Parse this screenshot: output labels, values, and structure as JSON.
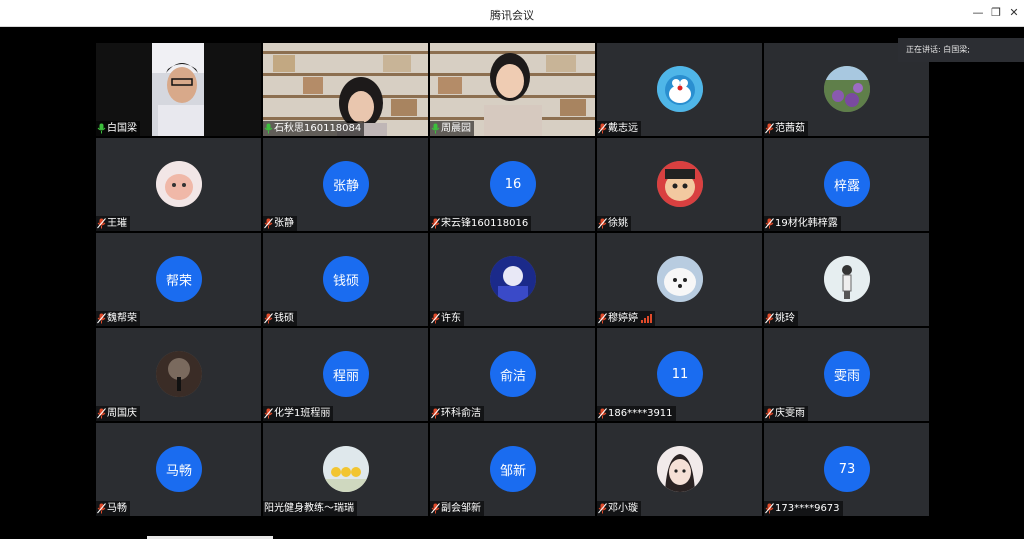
{
  "window": {
    "title": "腾讯会议",
    "speaking_label": "正在讲话: 白国梁;"
  },
  "colors": {
    "avatar_blue": "#1a6cf0",
    "tile_bg": "#2b2d31",
    "active_border": "#3c9b3c",
    "mic_on": "#3cbf3c",
    "mic_muted": "#e04a2a"
  },
  "participants": [
    {
      "name": "白国梁",
      "type": "video",
      "mic": "on",
      "active": true
    },
    {
      "name": "石秋思160118084",
      "type": "video",
      "mic": "on"
    },
    {
      "name": "周晨园",
      "type": "video",
      "mic": "on"
    },
    {
      "name": "戴志远",
      "type": "image",
      "mic": "muted",
      "icon": "doraemon-avatar"
    },
    {
      "name": "范茜茹",
      "type": "image",
      "mic": "muted",
      "icon": "flowers-avatar"
    },
    {
      "name": "王璀",
      "type": "image",
      "mic": "muted",
      "icon": "pink-face-avatar"
    },
    {
      "name": "张静",
      "type": "initials",
      "initials": "张静",
      "mic": "muted"
    },
    {
      "name": "宋云锋160118016",
      "type": "initials",
      "initials": "16",
      "mic": "muted"
    },
    {
      "name": "徐姚",
      "type": "image",
      "mic": "muted",
      "icon": "cartoon-boy-avatar"
    },
    {
      "name": "19材化韩梓露",
      "type": "initials",
      "initials": "梓露",
      "mic": "muted"
    },
    {
      "name": "魏帮荣",
      "type": "initials",
      "initials": "帮荣",
      "mic": "muted"
    },
    {
      "name": "钱硕",
      "type": "initials",
      "initials": "钱硕",
      "mic": "muted"
    },
    {
      "name": "许东",
      "type": "image",
      "mic": "muted",
      "icon": "anime-avatar"
    },
    {
      "name": "穆婷婷",
      "type": "image",
      "mic": "muted",
      "icon": "white-dog-avatar",
      "signal": true
    },
    {
      "name": "姚玲",
      "type": "image",
      "mic": "muted",
      "icon": "girl-standing-avatar"
    },
    {
      "name": "周国庆",
      "type": "image",
      "mic": "muted",
      "icon": "moon-avatar"
    },
    {
      "name": "化学1班程丽",
      "type": "initials",
      "initials": "程丽",
      "mic": "muted"
    },
    {
      "name": "环科俞洁",
      "type": "initials",
      "initials": "俞洁",
      "mic": "muted"
    },
    {
      "name": "186****3911",
      "type": "initials",
      "initials": "11",
      "mic": "muted"
    },
    {
      "name": "庆雯雨",
      "type": "initials",
      "initials": "雯雨",
      "mic": "muted"
    },
    {
      "name": "马畅",
      "type": "initials",
      "initials": "马畅",
      "mic": "muted"
    },
    {
      "name": "阳光健身教练～瑞瑞",
      "type": "image",
      "mic": "none",
      "icon": "ducks-avatar"
    },
    {
      "name": "副会邹新",
      "type": "initials",
      "initials": "邹新",
      "mic": "muted"
    },
    {
      "name": "邓小璇",
      "type": "image",
      "mic": "muted",
      "icon": "girl-face-avatar"
    },
    {
      "name": "173****9673",
      "type": "initials",
      "initials": "73",
      "mic": "muted"
    }
  ]
}
